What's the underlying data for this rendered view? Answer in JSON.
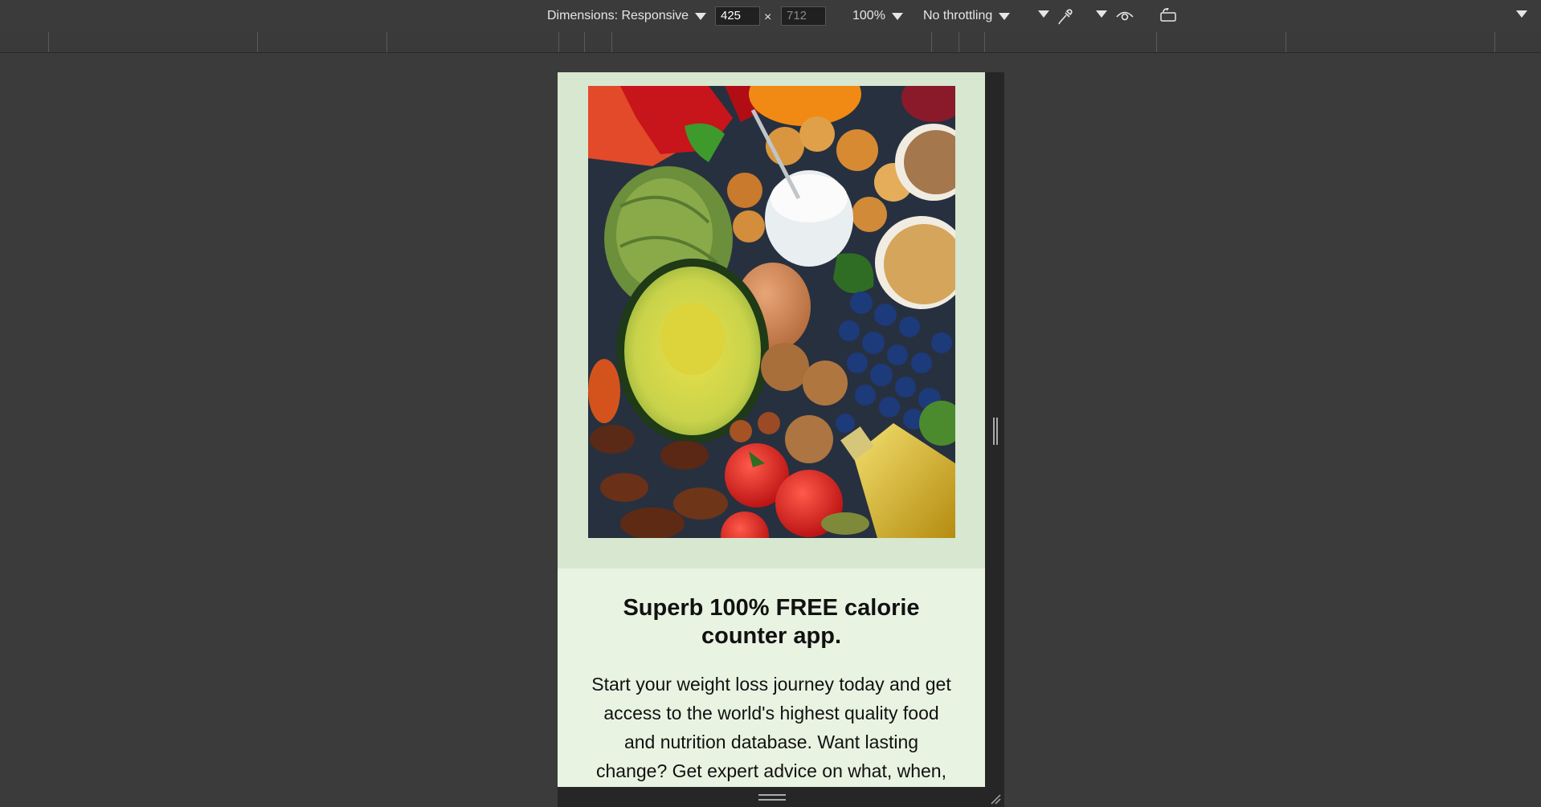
{
  "toolbar": {
    "dimensions_label": "Dimensions: Responsive",
    "width_value": "425",
    "height_value": "712",
    "times_symbol": "×",
    "zoom_label": "100%",
    "throttling_label": "No throttling",
    "icons": [
      "chevron-down-icon",
      "eyedropper-icon",
      "eye-icon",
      "rotate-device-icon"
    ]
  },
  "page": {
    "headline": "Superb 100% FREE calorie counter app.",
    "body": "Start your weight loss journey today and get access to the world's highest quality food and nutrition database. Want lasting change? Get expert advice on what, when,",
    "image_alt": "Healthy foods: vegetables, avocado, yogurt, egg, nuts, blueberries, tomatoes, olive oil",
    "colors": {
      "image_section_bg": "#d7e7d0",
      "text_section_bg": "#e8f3e2",
      "devtools_bg": "#3b3b3b"
    }
  }
}
